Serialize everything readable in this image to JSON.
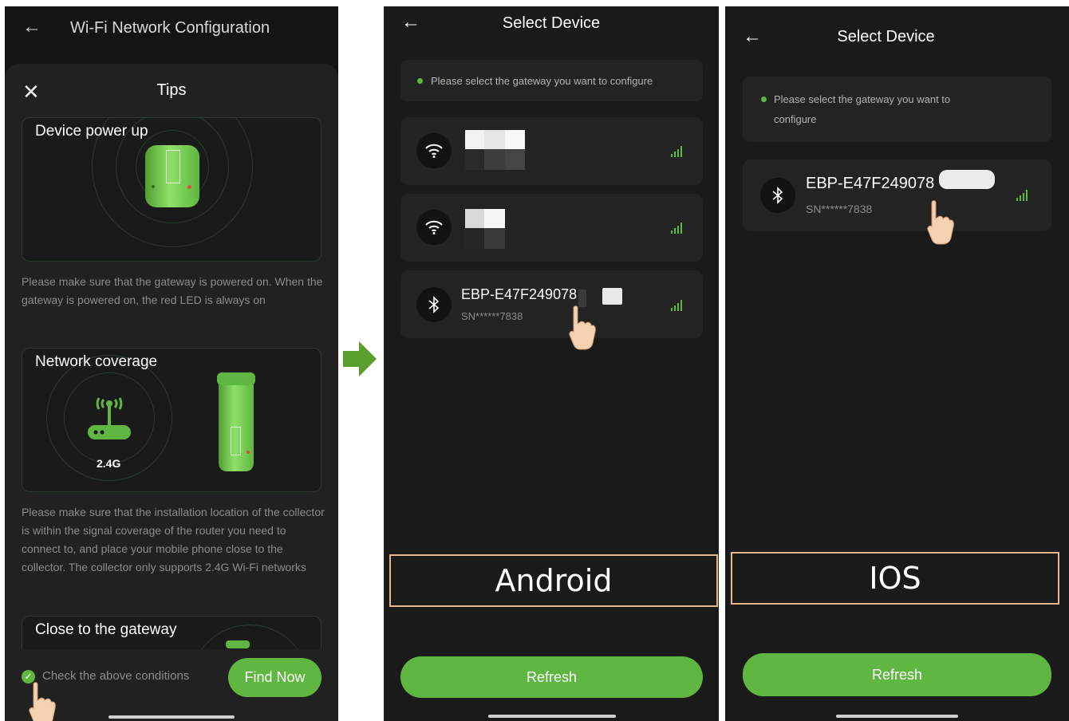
{
  "panel1": {
    "title": "Wi-Fi Network Configuration",
    "sheet_title": "Tips",
    "cards": [
      {
        "title": "Device power up",
        "text": "Please make sure that the gateway is powered on. When the gateway is powered on, the red LED is always on"
      },
      {
        "title": "Network coverage",
        "band": "2.4G",
        "text": "Please make sure that the installation location of the collector is within the signal coverage of the router you need to connect to, and place your mobile phone close to the collector. The collector only supports 2.4G Wi-Fi networks"
      },
      {
        "title": "Close to the gateway"
      }
    ],
    "check_label": "Check the above conditions",
    "find_button": "Find Now"
  },
  "panel2": {
    "title": "Select Device",
    "hint": "Please select the gateway you want to configure",
    "device_name": "EBP-E47F249078",
    "device_sn": "SN******7838",
    "platform_label": "Android",
    "refresh_button": "Refresh"
  },
  "panel3": {
    "title": "Select Device",
    "hint_line1": "Please select the gateway you want to",
    "hint_line2": "configure",
    "device_name": "EBP-E47F249078",
    "device_sn": "SN******7838",
    "platform_label": "IOS",
    "refresh_button": "Refresh"
  },
  "colors": {
    "accent": "#5fb640",
    "background": "#1a1a1a",
    "card": "#232323",
    "outline": "#e8b48a",
    "arrow": "#5a9e2e"
  }
}
